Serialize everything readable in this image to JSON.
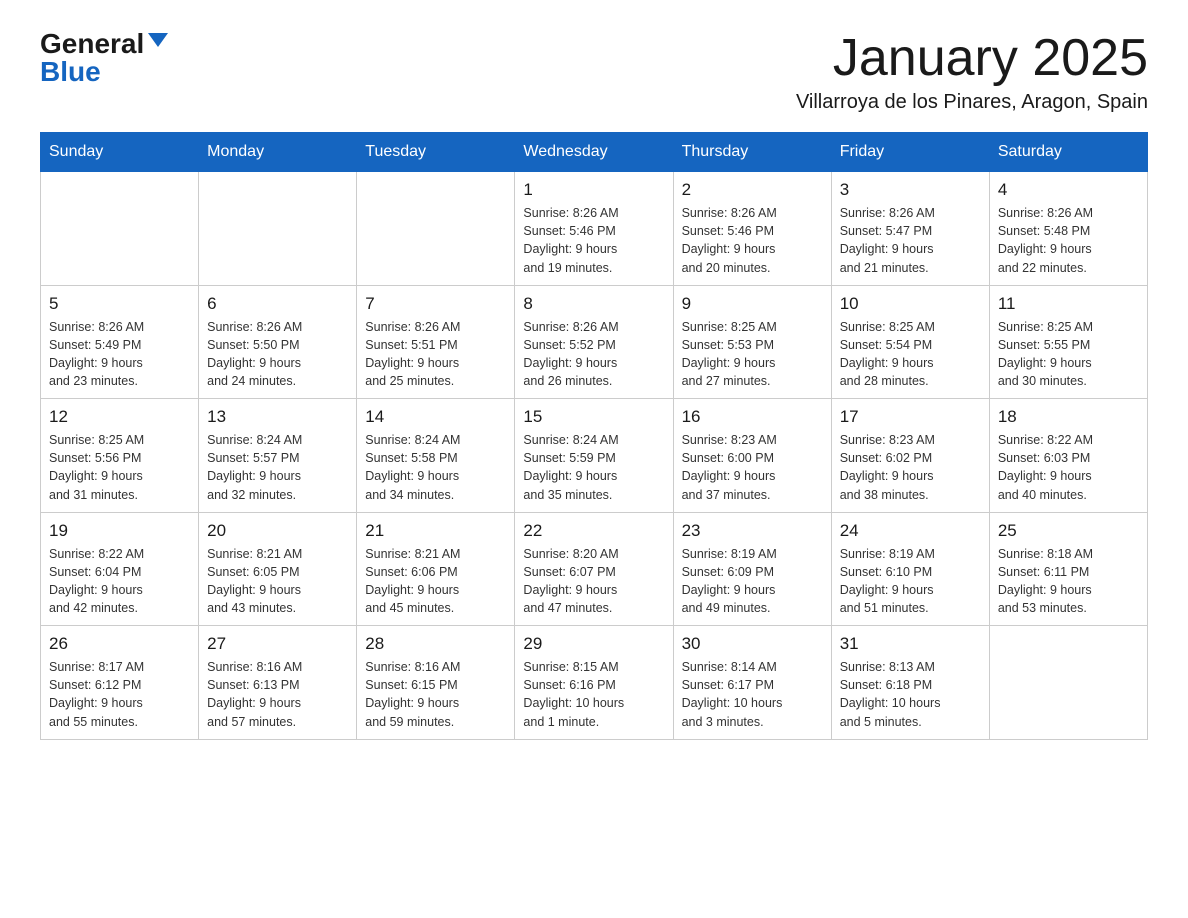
{
  "header": {
    "logo_general": "General",
    "logo_blue": "Blue",
    "title": "January 2025",
    "subtitle": "Villarroya de los Pinares, Aragon, Spain"
  },
  "weekdays": [
    "Sunday",
    "Monday",
    "Tuesday",
    "Wednesday",
    "Thursday",
    "Friday",
    "Saturday"
  ],
  "weeks": [
    [
      null,
      null,
      null,
      {
        "day": "1",
        "info": "Sunrise: 8:26 AM\nSunset: 5:46 PM\nDaylight: 9 hours\nand 19 minutes."
      },
      {
        "day": "2",
        "info": "Sunrise: 8:26 AM\nSunset: 5:46 PM\nDaylight: 9 hours\nand 20 minutes."
      },
      {
        "day": "3",
        "info": "Sunrise: 8:26 AM\nSunset: 5:47 PM\nDaylight: 9 hours\nand 21 minutes."
      },
      {
        "day": "4",
        "info": "Sunrise: 8:26 AM\nSunset: 5:48 PM\nDaylight: 9 hours\nand 22 minutes."
      }
    ],
    [
      {
        "day": "5",
        "info": "Sunrise: 8:26 AM\nSunset: 5:49 PM\nDaylight: 9 hours\nand 23 minutes."
      },
      {
        "day": "6",
        "info": "Sunrise: 8:26 AM\nSunset: 5:50 PM\nDaylight: 9 hours\nand 24 minutes."
      },
      {
        "day": "7",
        "info": "Sunrise: 8:26 AM\nSunset: 5:51 PM\nDaylight: 9 hours\nand 25 minutes."
      },
      {
        "day": "8",
        "info": "Sunrise: 8:26 AM\nSunset: 5:52 PM\nDaylight: 9 hours\nand 26 minutes."
      },
      {
        "day": "9",
        "info": "Sunrise: 8:25 AM\nSunset: 5:53 PM\nDaylight: 9 hours\nand 27 minutes."
      },
      {
        "day": "10",
        "info": "Sunrise: 8:25 AM\nSunset: 5:54 PM\nDaylight: 9 hours\nand 28 minutes."
      },
      {
        "day": "11",
        "info": "Sunrise: 8:25 AM\nSunset: 5:55 PM\nDaylight: 9 hours\nand 30 minutes."
      }
    ],
    [
      {
        "day": "12",
        "info": "Sunrise: 8:25 AM\nSunset: 5:56 PM\nDaylight: 9 hours\nand 31 minutes."
      },
      {
        "day": "13",
        "info": "Sunrise: 8:24 AM\nSunset: 5:57 PM\nDaylight: 9 hours\nand 32 minutes."
      },
      {
        "day": "14",
        "info": "Sunrise: 8:24 AM\nSunset: 5:58 PM\nDaylight: 9 hours\nand 34 minutes."
      },
      {
        "day": "15",
        "info": "Sunrise: 8:24 AM\nSunset: 5:59 PM\nDaylight: 9 hours\nand 35 minutes."
      },
      {
        "day": "16",
        "info": "Sunrise: 8:23 AM\nSunset: 6:00 PM\nDaylight: 9 hours\nand 37 minutes."
      },
      {
        "day": "17",
        "info": "Sunrise: 8:23 AM\nSunset: 6:02 PM\nDaylight: 9 hours\nand 38 minutes."
      },
      {
        "day": "18",
        "info": "Sunrise: 8:22 AM\nSunset: 6:03 PM\nDaylight: 9 hours\nand 40 minutes."
      }
    ],
    [
      {
        "day": "19",
        "info": "Sunrise: 8:22 AM\nSunset: 6:04 PM\nDaylight: 9 hours\nand 42 minutes."
      },
      {
        "day": "20",
        "info": "Sunrise: 8:21 AM\nSunset: 6:05 PM\nDaylight: 9 hours\nand 43 minutes."
      },
      {
        "day": "21",
        "info": "Sunrise: 8:21 AM\nSunset: 6:06 PM\nDaylight: 9 hours\nand 45 minutes."
      },
      {
        "day": "22",
        "info": "Sunrise: 8:20 AM\nSunset: 6:07 PM\nDaylight: 9 hours\nand 47 minutes."
      },
      {
        "day": "23",
        "info": "Sunrise: 8:19 AM\nSunset: 6:09 PM\nDaylight: 9 hours\nand 49 minutes."
      },
      {
        "day": "24",
        "info": "Sunrise: 8:19 AM\nSunset: 6:10 PM\nDaylight: 9 hours\nand 51 minutes."
      },
      {
        "day": "25",
        "info": "Sunrise: 8:18 AM\nSunset: 6:11 PM\nDaylight: 9 hours\nand 53 minutes."
      }
    ],
    [
      {
        "day": "26",
        "info": "Sunrise: 8:17 AM\nSunset: 6:12 PM\nDaylight: 9 hours\nand 55 minutes."
      },
      {
        "day": "27",
        "info": "Sunrise: 8:16 AM\nSunset: 6:13 PM\nDaylight: 9 hours\nand 57 minutes."
      },
      {
        "day": "28",
        "info": "Sunrise: 8:16 AM\nSunset: 6:15 PM\nDaylight: 9 hours\nand 59 minutes."
      },
      {
        "day": "29",
        "info": "Sunrise: 8:15 AM\nSunset: 6:16 PM\nDaylight: 10 hours\nand 1 minute."
      },
      {
        "day": "30",
        "info": "Sunrise: 8:14 AM\nSunset: 6:17 PM\nDaylight: 10 hours\nand 3 minutes."
      },
      {
        "day": "31",
        "info": "Sunrise: 8:13 AM\nSunset: 6:18 PM\nDaylight: 10 hours\nand 5 minutes."
      },
      null
    ]
  ]
}
